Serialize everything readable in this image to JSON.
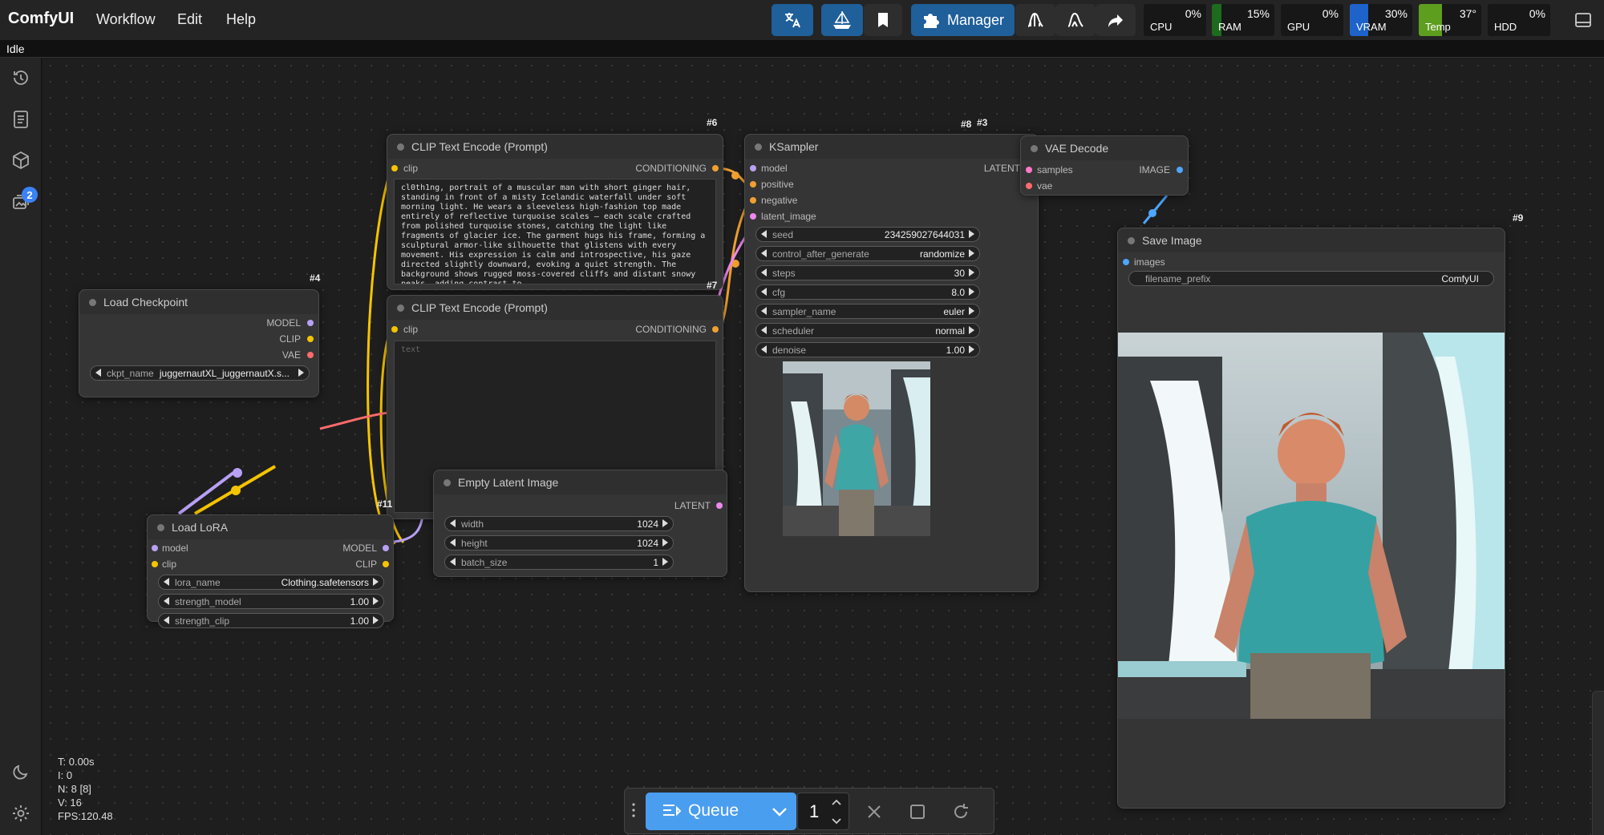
{
  "app": {
    "logo": "ComfyUI",
    "status": "Idle"
  },
  "menu": [
    {
      "label": "Workflow"
    },
    {
      "label": "Edit"
    },
    {
      "label": "Help"
    }
  ],
  "toolbar": {
    "manager_label": "Manager"
  },
  "monitors": [
    {
      "label": "CPU",
      "value": "0%",
      "fill": 0,
      "color": "#171717"
    },
    {
      "label": "RAM",
      "value": "15%",
      "fill": 0.15,
      "color": "#1d6b1d"
    },
    {
      "label": "GPU",
      "value": "0%",
      "fill": 0,
      "color": "#171717"
    },
    {
      "label": "VRAM",
      "value": "30%",
      "fill": 0.3,
      "color": "#1e63c9"
    },
    {
      "label": "Temp",
      "value": "37°",
      "fill": 0.37,
      "color": "#5e9e1f"
    },
    {
      "label": "HDD",
      "value": "0%",
      "fill": 0,
      "color": "#171717"
    }
  ],
  "sidebar": {
    "queue_badge": "2"
  },
  "nodes": {
    "clip1": {
      "id": "#6",
      "title": "CLIP Text Encode (Prompt)",
      "in_clip": "clip",
      "out": "CONDITIONING",
      "text": "cl0th1ng, portrait of a muscular man with short ginger hair, standing in front of a misty Icelandic waterfall under soft morning light. He wears a sleeveless high-fashion top made entirely of reflective turquoise scales — each scale crafted from polished turquoise stones, catching the light like fragments of glacier ice. The garment hugs his frame, forming a sculptural armor-like silhouette that glistens with every movement. His expression is calm and introspective, his gaze directed slightly downward, evoking a quiet strength. The background shows rugged moss-covered cliffs and distant snowy peaks, adding contrast to"
    },
    "clip2": {
      "id": "#7",
      "title": "CLIP Text Encode (Prompt)",
      "in_clip": "clip",
      "out": "CONDITIONING",
      "placeholder": "text"
    },
    "ksampler": {
      "id": "#3",
      "title": "KSampler",
      "inputs": [
        "model",
        "positive",
        "negative",
        "latent_image"
      ],
      "out": "LATENT",
      "widgets": [
        {
          "label": "seed",
          "value": "234259027644031"
        },
        {
          "label": "control_after_generate",
          "value": "randomize"
        },
        {
          "label": "steps",
          "value": "30"
        },
        {
          "label": "cfg",
          "value": "8.0"
        },
        {
          "label": "sampler_name",
          "value": "euler"
        },
        {
          "label": "scheduler",
          "value": "normal"
        },
        {
          "label": "denoise",
          "value": "1.00"
        }
      ]
    },
    "vae": {
      "id": "#8",
      "title": "VAE Decode",
      "inputs": [
        "samples",
        "vae"
      ],
      "out": "IMAGE"
    },
    "save": {
      "id": "#9",
      "title": "Save Image",
      "in": "images",
      "widget_label": "filename_prefix",
      "widget_value": "ComfyUI"
    },
    "checkpoint": {
      "id": "#4",
      "title": "Load Checkpoint",
      "outputs": [
        "MODEL",
        "CLIP",
        "VAE"
      ],
      "widget_label": "ckpt_name",
      "widget_value": "juggernautXL_juggernautX.s..."
    },
    "lora": {
      "id": "#11",
      "title": "Load LoRA",
      "inputs": [
        "model",
        "clip"
      ],
      "outputs": [
        "MODEL",
        "CLIP"
      ],
      "widgets": [
        {
          "label": "lora_name",
          "value": "Clothing.safetensors"
        },
        {
          "label": "strength_model",
          "value": "1.00"
        },
        {
          "label": "strength_clip",
          "value": "1.00"
        }
      ]
    },
    "latent": {
      "id": "#5",
      "title": "Empty Latent Image",
      "out": "LATENT",
      "widgets": [
        {
          "label": "width",
          "value": "1024"
        },
        {
          "label": "height",
          "value": "1024"
        },
        {
          "label": "batch_size",
          "value": "1"
        }
      ]
    }
  },
  "stats": {
    "t": "T: 0.00s",
    "i": "I: 0",
    "n": "N: 8 [8]",
    "v": "V: 16",
    "fps": "FPS:120.48"
  },
  "queue": {
    "label": "Queue",
    "count": "1"
  }
}
